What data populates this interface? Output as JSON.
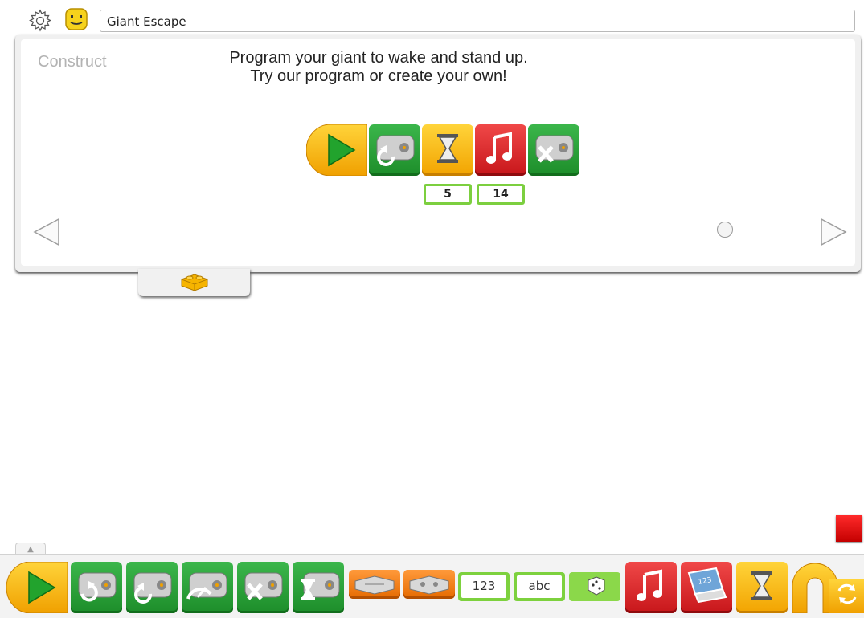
{
  "project": {
    "title": "Giant Escape"
  },
  "content": {
    "section_label": "Construct",
    "instruction_line1": "Program your giant to wake and stand up.",
    "instruction_line2": "Try our program or create your own!",
    "program": {
      "blocks": [
        {
          "name": "start-block",
          "type": "start"
        },
        {
          "name": "motor-counterclockwise-block",
          "type": "motor"
        },
        {
          "name": "wait-for-block",
          "type": "wait",
          "input": "5"
        },
        {
          "name": "play-sound-block",
          "type": "sound",
          "input": "14"
        },
        {
          "name": "motor-off-block",
          "type": "motor"
        }
      ]
    }
  },
  "palette": {
    "number_input_label": "123",
    "text_input_label": "abc",
    "items": [
      "start-block",
      "motor-clockwise-block",
      "motor-counterclockwise-block",
      "motor-power-block",
      "motor-off-block",
      "motor-on-for-block",
      "tilt-sensor-block",
      "distance-sensor-block",
      "number-input-block",
      "text-input-block",
      "random-input-block",
      "play-sound-block",
      "display-block",
      "wait-for-block",
      "repeat-block"
    ]
  },
  "colors": {
    "start": "#f7b500",
    "motor": "#1f9a2e",
    "sound": "#e02b2b",
    "sensor": "#ff8a1f",
    "input": "#7dd13e",
    "stop": "#e00000"
  }
}
